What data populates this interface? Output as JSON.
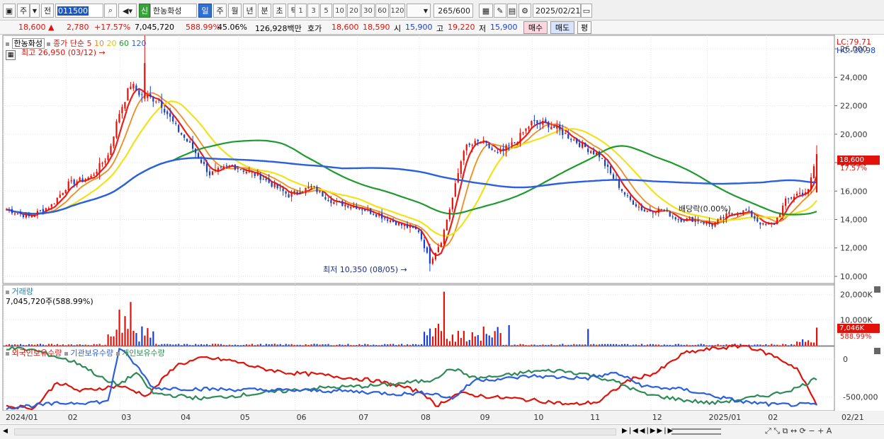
{
  "toolbar": {
    "period_labels": [
      "일",
      "주",
      "월",
      "년",
      "분",
      "초",
      "틱"
    ],
    "active_period": "일",
    "number_buttons": [
      "1",
      "3",
      "5",
      "10",
      "20",
      "30",
      "60",
      "120"
    ],
    "code": "011500",
    "stock_name": "한농화성",
    "market_badge": "신",
    "count": "265",
    "count_total": "/600",
    "date": "2025/02/21",
    "left_buttons": [
      "주",
      "전"
    ]
  },
  "quote": {
    "price": "18,600",
    "arrow": "▲",
    "change": "2,780",
    "change_pct": "+17.57%",
    "volume": "7,045,720",
    "volume_ratio": "588.99%",
    "turnover": "45.06%",
    "amount": "126,928백만",
    "bid_ask_label": "호가",
    "ask": "18,600",
    "bid": "18,590",
    "open_label": "시",
    "open": "15,900",
    "high_label": "고",
    "high": "19,220",
    "low_label": "저",
    "low": "15,900",
    "buy_label": "매수",
    "sell_label": "매도",
    "eval_label": "평"
  },
  "legend": {
    "stock": "한농화성",
    "ma_label": "종가 단순",
    "ma_periods": [
      "5",
      "10",
      "20",
      "60",
      "120"
    ],
    "ma_colors": [
      "#e8201a",
      "#f08c1e",
      "#f2e21a",
      "#1e9a2e",
      "#2a5fe0"
    ]
  },
  "annotations": {
    "max": "최고 26,950 (03/12)",
    "min": "최저 10,350 (08/05)",
    "dividend": "배당락(0.00%)",
    "lc": "LC:79.71",
    "hc": "HC:-30.98",
    "last_price": "18,600",
    "last_pct": "17.57%"
  },
  "volume_panel": {
    "title": "거래량",
    "value": "7,045,720주(588.99%)",
    "last_tag": "7,046K",
    "last_pct": "588.99%"
  },
  "holder_panel": {
    "legend": [
      "외국인보유수량",
      "기관보유수량",
      "개인보유수량"
    ],
    "colors": [
      "#e0120a",
      "#2a5fe0",
      "#2e8b57"
    ]
  },
  "chart_data": {
    "type": "candlestick",
    "price_axis": {
      "ticks": [
        "26,000",
        "24,000",
        "22,000",
        "20,000",
        "18,000",
        "16,000",
        "14,000",
        "12,000",
        "10,000"
      ],
      "ylim": [
        9500,
        27000
      ]
    },
    "volume_axis": {
      "ticks": [
        "20,000K",
        "10,000K"
      ],
      "ylim": [
        0,
        22000
      ]
    },
    "holder_axis": {
      "ticks": [
        "0",
        "-500,000"
      ],
      "ylim": [
        -680000,
        170000
      ]
    },
    "x_axis_labels": [
      "2024/01",
      "02",
      "03",
      "04",
      "05",
      "06",
      "07",
      "08",
      "09",
      "10",
      "11",
      "12",
      "2025/01",
      "02",
      "02/21"
    ],
    "anchor_closes": [
      [
        0,
        14700
      ],
      [
        8,
        14200
      ],
      [
        16,
        15000
      ],
      [
        22,
        16500
      ],
      [
        30,
        17000
      ],
      [
        36,
        18500
      ],
      [
        40,
        21500
      ],
      [
        44,
        23500
      ],
      [
        48,
        22700
      ],
      [
        54,
        22400
      ],
      [
        60,
        20500
      ],
      [
        66,
        19000
      ],
      [
        72,
        17200
      ],
      [
        80,
        17800
      ],
      [
        90,
        17000
      ],
      [
        100,
        15700
      ],
      [
        108,
        16300
      ],
      [
        116,
        15200
      ],
      [
        124,
        14900
      ],
      [
        132,
        14300
      ],
      [
        140,
        13600
      ],
      [
        146,
        13200
      ],
      [
        150,
        11000
      ],
      [
        154,
        12500
      ],
      [
        158,
        15500
      ],
      [
        162,
        19000
      ],
      [
        168,
        19500
      ],
      [
        174,
        18600
      ],
      [
        180,
        19400
      ],
      [
        186,
        20800
      ],
      [
        192,
        20700
      ],
      [
        198,
        20000
      ],
      [
        204,
        19200
      ],
      [
        210,
        18500
      ],
      [
        214,
        17200
      ],
      [
        220,
        15500
      ],
      [
        226,
        14600
      ],
      [
        232,
        14700
      ],
      [
        238,
        14000
      ],
      [
        244,
        14000
      ],
      [
        250,
        13600
      ],
      [
        256,
        14400
      ],
      [
        262,
        14600
      ],
      [
        268,
        13600
      ],
      [
        272,
        13700
      ],
      [
        276,
        15300
      ],
      [
        280,
        15800
      ],
      [
        284,
        16000
      ],
      [
        287,
        18600
      ]
    ],
    "holder_series": {
      "foreign": [
        [
          0,
          -620000
        ],
        [
          10,
          -640000
        ],
        [
          18,
          -300000
        ],
        [
          26,
          -420000
        ],
        [
          40,
          -350000
        ],
        [
          50,
          -480000
        ],
        [
          60,
          -80000
        ],
        [
          70,
          20000
        ],
        [
          80,
          -20000
        ],
        [
          90,
          -120000
        ],
        [
          100,
          -180000
        ],
        [
          110,
          -200000
        ],
        [
          130,
          -280000
        ],
        [
          140,
          -360000
        ],
        [
          148,
          -450000
        ],
        [
          152,
          -620000
        ],
        [
          160,
          -450000
        ],
        [
          172,
          -500000
        ],
        [
          180,
          -520000
        ],
        [
          192,
          -560000
        ],
        [
          200,
          -600000
        ],
        [
          210,
          -560000
        ],
        [
          220,
          -280000
        ],
        [
          230,
          -180000
        ],
        [
          240,
          80000
        ],
        [
          250,
          140000
        ],
        [
          262,
          180000
        ],
        [
          272,
          40000
        ],
        [
          280,
          -120000
        ],
        [
          287,
          -600000
        ]
      ],
      "institution": [
        [
          0,
          -640000
        ],
        [
          20,
          -580000
        ],
        [
          36,
          -560000
        ],
        [
          40,
          150000
        ],
        [
          46,
          -80000
        ],
        [
          52,
          -380000
        ],
        [
          80,
          -400000
        ],
        [
          120,
          -420000
        ],
        [
          140,
          -460000
        ],
        [
          150,
          -440000
        ],
        [
          158,
          -520000
        ],
        [
          166,
          -270000
        ],
        [
          176,
          -260000
        ],
        [
          186,
          -220000
        ],
        [
          196,
          -240000
        ],
        [
          206,
          -250000
        ],
        [
          216,
          -180000
        ],
        [
          226,
          -360000
        ],
        [
          240,
          -400000
        ],
        [
          260,
          -560000
        ],
        [
          272,
          -600000
        ],
        [
          287,
          -600000
        ]
      ],
      "individual": [
        [
          0,
          150000
        ],
        [
          10,
          120000
        ],
        [
          26,
          -60000
        ],
        [
          36,
          -300000
        ],
        [
          40,
          -330000
        ],
        [
          46,
          -180000
        ],
        [
          52,
          -450000
        ],
        [
          70,
          -520000
        ],
        [
          90,
          -450000
        ],
        [
          110,
          -380000
        ],
        [
          130,
          -350000
        ],
        [
          150,
          -280000
        ],
        [
          158,
          -120000
        ],
        [
          166,
          -250000
        ],
        [
          176,
          -220000
        ],
        [
          186,
          -160000
        ],
        [
          196,
          -150000
        ],
        [
          206,
          -200000
        ],
        [
          216,
          -300000
        ],
        [
          226,
          -460000
        ],
        [
          240,
          -540000
        ],
        [
          250,
          -580000
        ],
        [
          262,
          -520000
        ],
        [
          272,
          -460000
        ],
        [
          280,
          -380000
        ],
        [
          287,
          -250000
        ]
      ]
    }
  }
}
